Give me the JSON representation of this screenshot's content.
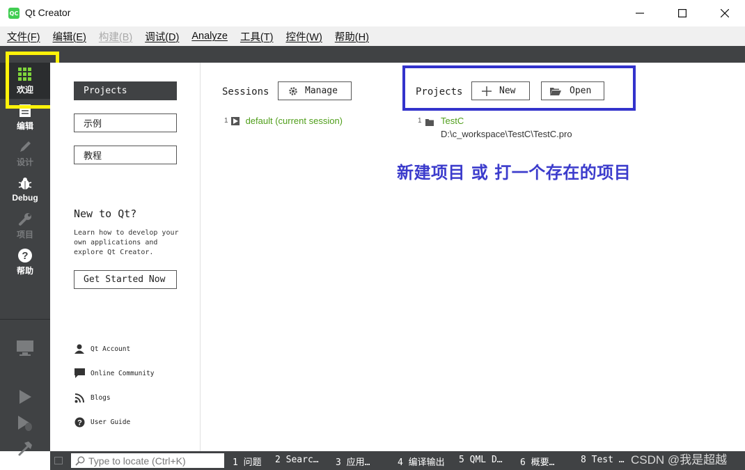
{
  "window": {
    "app_icon_text": "QC",
    "title": "Qt Creator"
  },
  "menubar": {
    "items": [
      {
        "label": "文件(F)",
        "enabled": true
      },
      {
        "label": "编辑(E)",
        "enabled": true
      },
      {
        "label": "构建(B)",
        "enabled": false
      },
      {
        "label": "调试(D)",
        "enabled": true
      },
      {
        "label": "Analyze",
        "enabled": true
      },
      {
        "label": "工具(T)",
        "enabled": true
      },
      {
        "label": "控件(W)",
        "enabled": true
      },
      {
        "label": "帮助(H)",
        "enabled": true
      }
    ]
  },
  "modebar": {
    "welcome": "欢迎",
    "edit": "编辑",
    "design": "设计",
    "debug": "Debug",
    "projects": "项目",
    "help": "帮助"
  },
  "welcome_sidebar": {
    "projects_button": "Projects",
    "examples_button": "示例",
    "tutorials_button": "教程",
    "new_to_qt_title": "New to Qt?",
    "new_to_qt_text": "Learn how to develop your own applications and explore Qt Creator.",
    "get_started_button": "Get Started Now",
    "links": {
      "qt_account": "Qt Account",
      "online_community": "Online Community",
      "blogs": "Blogs",
      "user_guide": "User Guide"
    }
  },
  "sessions": {
    "label": "Sessions",
    "manage_button": "Manage",
    "items": [
      {
        "index": "1",
        "name": "default (current session)"
      }
    ]
  },
  "projects": {
    "label": "Projects",
    "new_button": "New",
    "open_button": "Open",
    "recent": [
      {
        "index": "1",
        "name": "TestC",
        "path": "D:\\c_workspace\\TestC\\TestC.pro"
      }
    ]
  },
  "annotation": "新建项目 或 打一个存在的项目",
  "statusbar": {
    "locator_placeholder": "Type to locate (Ctrl+K)",
    "panes": [
      "1 问题",
      "2 Searc…",
      "3 应用…",
      "4 编译输出",
      "5 QML D…",
      "6 概要…",
      "8 Test …"
    ]
  },
  "watermark": "CSDN @我是超越",
  "colors": {
    "dark_panel": "#404244",
    "link_green": "#4f9e1a",
    "annotation_blue": "#3c3ccc",
    "highlight_yellow": "#fff20a"
  }
}
